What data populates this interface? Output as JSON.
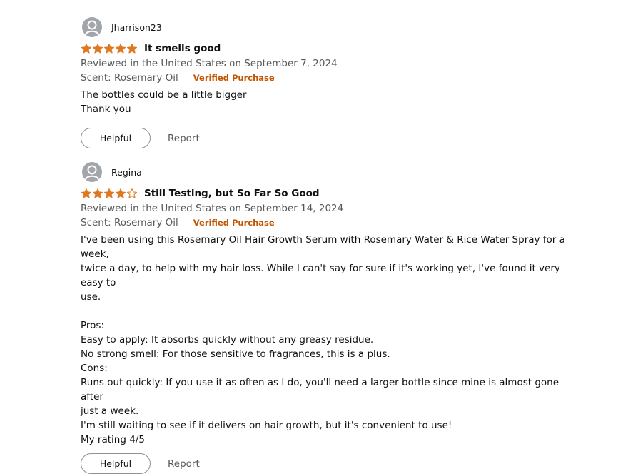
{
  "colors": {
    "star": "#de7921",
    "verified": "#c45500",
    "muted": "#565959",
    "avatar": "#a2a6ac"
  },
  "reviews": [
    {
      "reviewer": "Jharrison23",
      "rating": 5,
      "title": "It smells good",
      "date_line": "Reviewed in the United States on September 7, 2024",
      "scent": "Scent: Rosemary Oil",
      "verified": "Verified Purchase",
      "body_lines": [
        "The bottles could be a little bigger",
        "Thank you"
      ],
      "helpful": "Helpful",
      "report": "Report"
    },
    {
      "reviewer": "Regina",
      "rating": 4,
      "title": "Still Testing, but So Far So Good",
      "date_line": "Reviewed in the United States on September 14, 2024",
      "scent": "Scent: Rosemary Oil",
      "verified": "Verified Purchase",
      "body_lines": [
        "I've been using this Rosemary Oil Hair Growth Serum with Rosemary Water & Rice Water Spray for a week,",
        "twice a day, to help with my hair loss. While I can't say for sure if it's working yet, I've found it very easy to",
        "use.",
        "",
        "Pros:",
        "Easy to apply: It absorbs quickly without any greasy residue.",
        "No strong smell: For those sensitive to fragrances, this is a plus.",
        "Cons:",
        "Runs out quickly: If you use it as often as I do, you'll need a larger bottle since mine is almost gone after",
        "just a week.",
        "I'm still waiting to see if it delivers on hair growth, but it's convenient to use!",
        "My rating 4/5"
      ],
      "helpful": "Helpful",
      "report": "Report"
    }
  ]
}
